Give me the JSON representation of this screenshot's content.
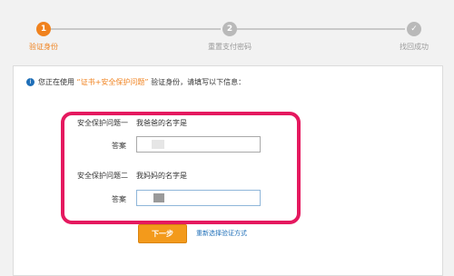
{
  "steps": [
    {
      "number": "1",
      "label": "验证身份",
      "state": "active"
    },
    {
      "number": "2",
      "label": "重置支付密码",
      "state": "inactive"
    },
    {
      "number": "✓",
      "label": "找回成功",
      "state": "inactive"
    }
  ],
  "info": {
    "icon": "info-icon",
    "prefix": "您正在使用",
    "method": "“证书+安全保护问题”",
    "suffix": "验证身份，请填写以下信息："
  },
  "form": {
    "question1_label": "安全保护问题一",
    "question1_text": "我爸爸的名字是",
    "answer1_label": "答案",
    "question2_label": "安全保护问题二",
    "question2_text": "我妈妈的名字是",
    "answer2_label": "答案"
  },
  "actions": {
    "next_label": "下一步",
    "alt_link": "重新选择验证方式"
  },
  "colors": {
    "accent": "#f0821e",
    "highlight_border": "#e5195f",
    "link": "#1f6fb8"
  }
}
